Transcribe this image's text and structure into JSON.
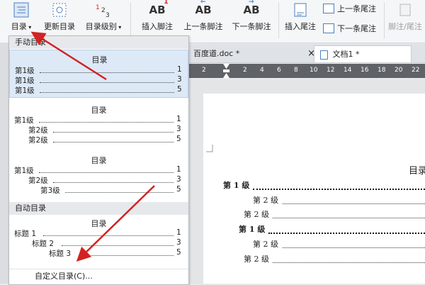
{
  "ribbon": {
    "toc_label": "目录",
    "update_toc_label": "更新目录",
    "toc_level_label": "目录级别",
    "insert_footnote_label": "插入脚注",
    "prev_footnote_label": "上一条脚注",
    "next_footnote_label": "下一条脚注",
    "insert_endnote_label": "插入尾注",
    "prev_endnote_label": "上一条尾注",
    "next_endnote_label": "下一条尾注",
    "footnote_endnote_label": "脚注/尾注",
    "accent_color": "#d22222"
  },
  "tabs": [
    {
      "label": "百度道.doc *"
    },
    {
      "label": "文档1 *"
    }
  ],
  "close_glyph": "×",
  "ruler": {
    "ticks": [
      "2",
      "2",
      "4",
      "6",
      "8",
      "10",
      "12",
      "14",
      "16",
      "18",
      "20",
      "22"
    ]
  },
  "dropdown": {
    "manual_header": "手动目录",
    "auto_header": "自动目录",
    "custom_label": "自定义目录(C)...",
    "manual_options": [
      {
        "title": "目录",
        "entries": [
          {
            "text": "第1级",
            "page": "1"
          },
          {
            "text": "第1级",
            "page": "3"
          },
          {
            "text": "第1级",
            "page": "5"
          }
        ]
      },
      {
        "title": "目录",
        "entries": [
          {
            "text": "第1级",
            "page": "1"
          },
          {
            "text": "第2级",
            "page": "3"
          },
          {
            "text": "第2级",
            "page": "5"
          }
        ]
      },
      {
        "title": "目录",
        "entries": [
          {
            "text": "第1级",
            "page": "1"
          },
          {
            "text": "第2级",
            "page": "3"
          },
          {
            "text": "第3级",
            "page": "5"
          }
        ]
      }
    ],
    "auto_option": {
      "title": "目录",
      "entries": [
        {
          "text": "标题 1",
          "page": "1"
        },
        {
          "text": "标题 2",
          "page": "3"
        },
        {
          "text": "标题 3",
          "page": "5"
        }
      ]
    }
  },
  "document": {
    "toc_title": "目录",
    "lines": [
      {
        "text": "第 1 级",
        "bold": true
      },
      {
        "text": "第 2 级",
        "bold": false
      },
      {
        "text": "第 2 级",
        "bold": false
      },
      {
        "text": "第 1 级",
        "bold": true
      },
      {
        "text": "第 2 级",
        "bold": false
      },
      {
        "text": "第 2 级",
        "bold": false
      }
    ]
  }
}
